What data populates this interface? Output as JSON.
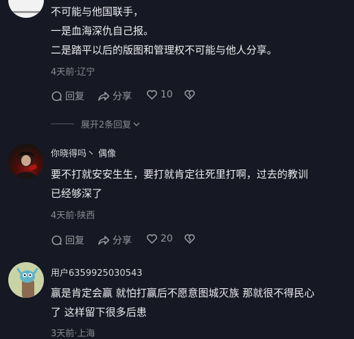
{
  "comment1": {
    "lines": [
      "不可能与他国联手，",
      "一是血海深仇自己报。",
      "二是踏平以后的版图和管理权不可能与他人分享。"
    ],
    "meta": "4天前·辽宁",
    "reply_label": "回复",
    "share_label": "分享",
    "like_count": "10",
    "expand_label": "展开2条回复"
  },
  "comment2": {
    "username": "你晓得吗丶 偶像",
    "lines": [
      "要不打就安安生生，要打就肯定往死里打啊，过去的教训",
      "已经够深了"
    ],
    "meta": "4天前·陕西",
    "reply_label": "回复",
    "share_label": "分享",
    "like_count": "20"
  },
  "comment3": {
    "username": "用户6359925030543",
    "lines": [
      "赢是肯定会赢 就怕打赢后不愿意图城灭族 那就很不得民心",
      "了 这样留下很多后患"
    ],
    "meta": "3天前·上海"
  },
  "colors": {
    "background": "#161823",
    "text": "#ececee",
    "muted": "#8a8b91"
  }
}
